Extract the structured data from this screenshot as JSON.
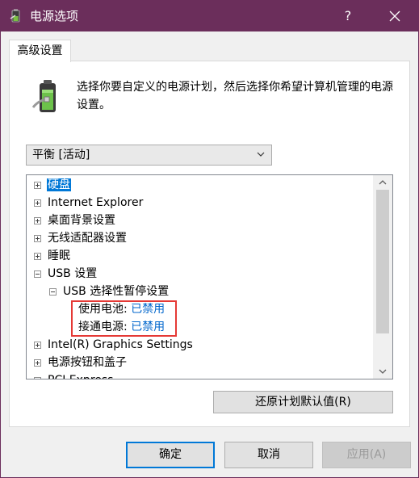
{
  "window": {
    "title": "电源选项",
    "help_label": "?",
    "title_bar_color": "#6b2e5b"
  },
  "tabs": [
    {
      "label": "高级设置"
    }
  ],
  "description": "选择你要自定义的电源计划，然后选择你希望计算机管理的电源设置。",
  "plan_select": {
    "value": "平衡 [活动]"
  },
  "tree": {
    "items": [
      {
        "label": "硬盘",
        "expander": "plus",
        "selected": true
      },
      {
        "label": "Internet Explorer",
        "expander": "plus"
      },
      {
        "label": "桌面背景设置",
        "expander": "plus"
      },
      {
        "label": "无线适配器设置",
        "expander": "plus"
      },
      {
        "label": "睡眠",
        "expander": "plus"
      },
      {
        "label": "USB 设置",
        "expander": "minus"
      },
      {
        "label": "USB 选择性暂停设置",
        "expander": "minus"
      },
      {
        "label": "使用电池:",
        "value": "已禁用"
      },
      {
        "label": "接通电源:",
        "value": "已禁用"
      },
      {
        "label": "Intel(R) Graphics Settings",
        "expander": "plus"
      },
      {
        "label": "电源按钮和盖子",
        "expander": "plus"
      },
      {
        "label": "PCI Express",
        "expander": "plus"
      }
    ]
  },
  "restore_button": "还原计划默认值(R)",
  "buttons": {
    "ok": "确定",
    "cancel": "取消",
    "apply": "应用(A)"
  },
  "colors": {
    "accent": "#0078d7",
    "highlight_box": "#e53935"
  }
}
